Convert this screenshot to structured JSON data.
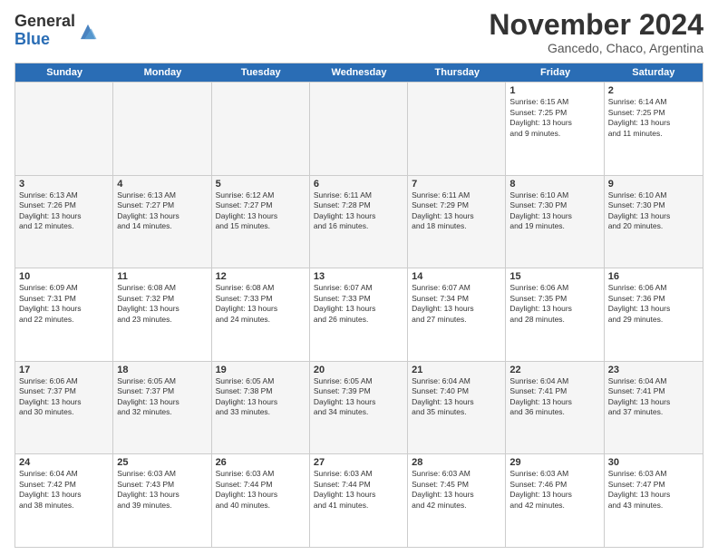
{
  "logo": {
    "general": "General",
    "blue": "Blue"
  },
  "header": {
    "month": "November 2024",
    "location": "Gancedo, Chaco, Argentina"
  },
  "days_of_week": [
    "Sunday",
    "Monday",
    "Tuesday",
    "Wednesday",
    "Thursday",
    "Friday",
    "Saturday"
  ],
  "weeks": [
    [
      {
        "day": "",
        "info": "",
        "empty": true
      },
      {
        "day": "",
        "info": "",
        "empty": true
      },
      {
        "day": "",
        "info": "",
        "empty": true
      },
      {
        "day": "",
        "info": "",
        "empty": true
      },
      {
        "day": "",
        "info": "",
        "empty": true
      },
      {
        "day": "1",
        "info": "Sunrise: 6:15 AM\nSunset: 7:25 PM\nDaylight: 13 hours\nand 9 minutes."
      },
      {
        "day": "2",
        "info": "Sunrise: 6:14 AM\nSunset: 7:25 PM\nDaylight: 13 hours\nand 11 minutes."
      }
    ],
    [
      {
        "day": "3",
        "info": "Sunrise: 6:13 AM\nSunset: 7:26 PM\nDaylight: 13 hours\nand 12 minutes."
      },
      {
        "day": "4",
        "info": "Sunrise: 6:13 AM\nSunset: 7:27 PM\nDaylight: 13 hours\nand 14 minutes."
      },
      {
        "day": "5",
        "info": "Sunrise: 6:12 AM\nSunset: 7:27 PM\nDaylight: 13 hours\nand 15 minutes."
      },
      {
        "day": "6",
        "info": "Sunrise: 6:11 AM\nSunset: 7:28 PM\nDaylight: 13 hours\nand 16 minutes."
      },
      {
        "day": "7",
        "info": "Sunrise: 6:11 AM\nSunset: 7:29 PM\nDaylight: 13 hours\nand 18 minutes."
      },
      {
        "day": "8",
        "info": "Sunrise: 6:10 AM\nSunset: 7:30 PM\nDaylight: 13 hours\nand 19 minutes."
      },
      {
        "day": "9",
        "info": "Sunrise: 6:10 AM\nSunset: 7:30 PM\nDaylight: 13 hours\nand 20 minutes."
      }
    ],
    [
      {
        "day": "10",
        "info": "Sunrise: 6:09 AM\nSunset: 7:31 PM\nDaylight: 13 hours\nand 22 minutes."
      },
      {
        "day": "11",
        "info": "Sunrise: 6:08 AM\nSunset: 7:32 PM\nDaylight: 13 hours\nand 23 minutes."
      },
      {
        "day": "12",
        "info": "Sunrise: 6:08 AM\nSunset: 7:33 PM\nDaylight: 13 hours\nand 24 minutes."
      },
      {
        "day": "13",
        "info": "Sunrise: 6:07 AM\nSunset: 7:33 PM\nDaylight: 13 hours\nand 26 minutes."
      },
      {
        "day": "14",
        "info": "Sunrise: 6:07 AM\nSunset: 7:34 PM\nDaylight: 13 hours\nand 27 minutes."
      },
      {
        "day": "15",
        "info": "Sunrise: 6:06 AM\nSunset: 7:35 PM\nDaylight: 13 hours\nand 28 minutes."
      },
      {
        "day": "16",
        "info": "Sunrise: 6:06 AM\nSunset: 7:36 PM\nDaylight: 13 hours\nand 29 minutes."
      }
    ],
    [
      {
        "day": "17",
        "info": "Sunrise: 6:06 AM\nSunset: 7:37 PM\nDaylight: 13 hours\nand 30 minutes."
      },
      {
        "day": "18",
        "info": "Sunrise: 6:05 AM\nSunset: 7:37 PM\nDaylight: 13 hours\nand 32 minutes."
      },
      {
        "day": "19",
        "info": "Sunrise: 6:05 AM\nSunset: 7:38 PM\nDaylight: 13 hours\nand 33 minutes."
      },
      {
        "day": "20",
        "info": "Sunrise: 6:05 AM\nSunset: 7:39 PM\nDaylight: 13 hours\nand 34 minutes."
      },
      {
        "day": "21",
        "info": "Sunrise: 6:04 AM\nSunset: 7:40 PM\nDaylight: 13 hours\nand 35 minutes."
      },
      {
        "day": "22",
        "info": "Sunrise: 6:04 AM\nSunset: 7:41 PM\nDaylight: 13 hours\nand 36 minutes."
      },
      {
        "day": "23",
        "info": "Sunrise: 6:04 AM\nSunset: 7:41 PM\nDaylight: 13 hours\nand 37 minutes."
      }
    ],
    [
      {
        "day": "24",
        "info": "Sunrise: 6:04 AM\nSunset: 7:42 PM\nDaylight: 13 hours\nand 38 minutes."
      },
      {
        "day": "25",
        "info": "Sunrise: 6:03 AM\nSunset: 7:43 PM\nDaylight: 13 hours\nand 39 minutes."
      },
      {
        "day": "26",
        "info": "Sunrise: 6:03 AM\nSunset: 7:44 PM\nDaylight: 13 hours\nand 40 minutes."
      },
      {
        "day": "27",
        "info": "Sunrise: 6:03 AM\nSunset: 7:44 PM\nDaylight: 13 hours\nand 41 minutes."
      },
      {
        "day": "28",
        "info": "Sunrise: 6:03 AM\nSunset: 7:45 PM\nDaylight: 13 hours\nand 42 minutes."
      },
      {
        "day": "29",
        "info": "Sunrise: 6:03 AM\nSunset: 7:46 PM\nDaylight: 13 hours\nand 42 minutes."
      },
      {
        "day": "30",
        "info": "Sunrise: 6:03 AM\nSunset: 7:47 PM\nDaylight: 13 hours\nand 43 minutes."
      }
    ]
  ]
}
